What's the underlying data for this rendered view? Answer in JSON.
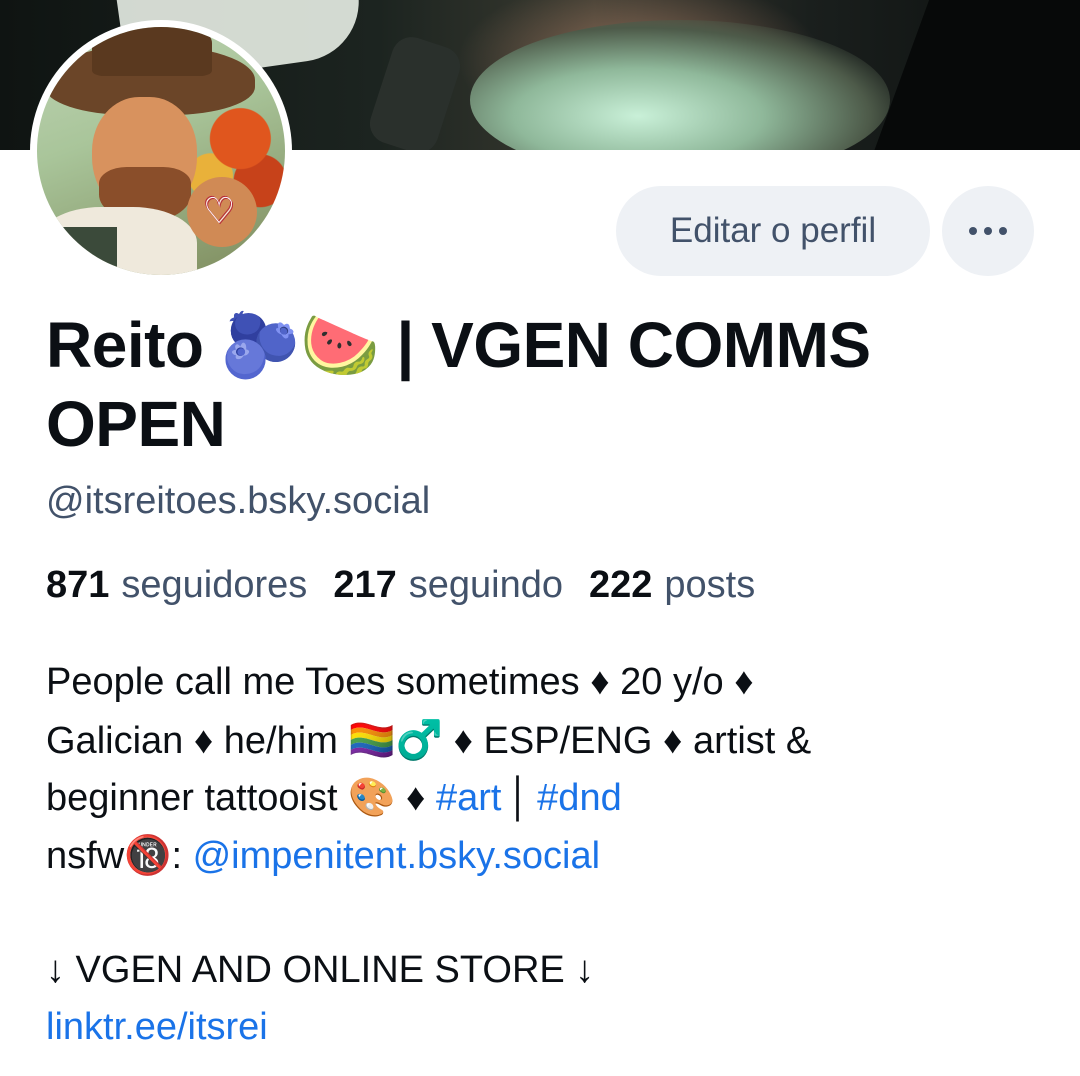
{
  "profile": {
    "edit_button_label": "Editar o perfil",
    "more_icon": "ellipsis-icon",
    "avatar_badge_icon": "heart-icon",
    "name_part1": "Reito ",
    "name_emoji_1": "🫐",
    "name_emoji_2": "🍉",
    "name_part2": " | VGEN COMMS",
    "name_part3": "OPEN",
    "handle": "@itsreitoes.bsky.social"
  },
  "stats": {
    "followers_count": "871",
    "followers_label": "seguidores",
    "following_count": "217",
    "following_label": "seguindo",
    "posts_count": "222",
    "posts_label": "posts"
  },
  "bio": {
    "line1": "People call me Toes sometimes ♦ 20 y/o ♦",
    "line2_a": "Galician ♦ he/him ",
    "line2_emoji": "🏳️‍🌈♂️",
    "line2_b": " ♦  ESP/ENG ♦ artist &",
    "line3_a": "beginner tattooist ",
    "line3_emoji": "🎨",
    "line3_b": " ♦ ",
    "hashtag_art": "#art",
    "separator": "│",
    "hashtag_dnd": "#dnd",
    "line4_a": "nsfw",
    "line4_emoji": "🔞",
    "line4_b": ": ",
    "nsfw_link": "@impenitent.bsky.social",
    "line6": "↓ VGEN AND ONLINE STORE ↓",
    "store_link": "linktr.ee/itsrei"
  },
  "colors": {
    "link": "#1a73e8",
    "secondary_text": "#42526a",
    "button_bg": "#eef1f5"
  }
}
